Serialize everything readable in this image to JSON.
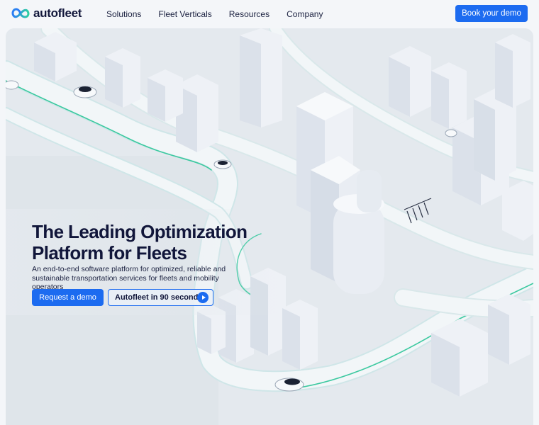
{
  "brand": {
    "name": "autofleet",
    "accent": "#1c6bf0",
    "logo_gradient": [
      "#2b7df5",
      "#2ecfa0"
    ]
  },
  "nav": {
    "items": [
      {
        "label": "Solutions"
      },
      {
        "label": "Fleet Verticals"
      },
      {
        "label": "Resources"
      },
      {
        "label": "Company"
      }
    ],
    "cta": "Book your demo"
  },
  "hero": {
    "title_line1": "The Leading Optimization",
    "title_line2": "Platform for Fleets",
    "subtitle_line1": "An end-to-end software platform for optimized, reliable and",
    "subtitle_line2": "sustainable transportation services for fleets and mobility operators",
    "primary_cta": "Request a demo",
    "secondary_cta": "Autofleet in 90 seconds",
    "secondary_icon": "play-icon",
    "background": "isometric-city-illustration"
  }
}
